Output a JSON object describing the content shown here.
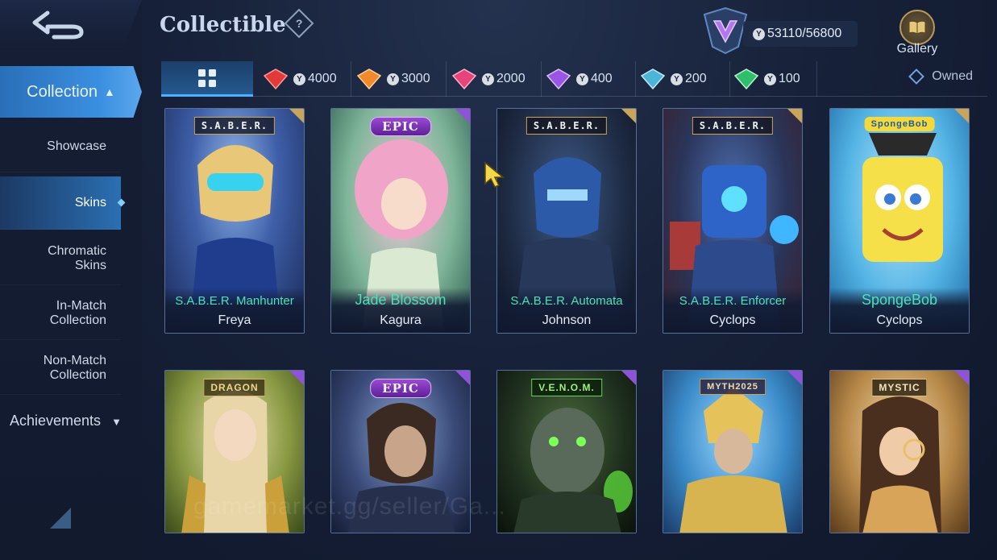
{
  "header": {
    "title": "Collectible",
    "help_symbol": "?",
    "points": "53110/56800",
    "gallery_label": "Gallery"
  },
  "sidebar": {
    "collection_label": "Collection",
    "items": [
      {
        "label": "Showcase"
      },
      {
        "label": "Skins",
        "active": true
      },
      {
        "label": "Chromatic\nSkins"
      },
      {
        "label": "In-Match\nCollection"
      },
      {
        "label": "Non-Match\nCollection"
      }
    ],
    "achievements_label": "Achievements"
  },
  "filters": {
    "tabs": [
      {
        "value": "4000",
        "color": "#e03a3a"
      },
      {
        "value": "3000",
        "color": "#f08a2a"
      },
      {
        "value": "2000",
        "color": "#e8437a"
      },
      {
        "value": "400",
        "color": "#9a55e6"
      },
      {
        "value": "200",
        "color": "#4cb6d8"
      },
      {
        "value": "100",
        "color": "#2fbf6b"
      }
    ],
    "owned_label": "Owned"
  },
  "cards": [
    {
      "badge": "S.A.B.E.R.",
      "skin": "S.A.B.E.R. Manhunter",
      "hero": "Freya"
    },
    {
      "badge": "EPIC",
      "skin": "Jade Blossom",
      "hero": "Kagura"
    },
    {
      "badge": "S.A.B.E.R.",
      "skin": "S.A.B.E.R. Automata",
      "hero": "Johnson"
    },
    {
      "badge": "S.A.B.E.R.",
      "skin": "S.A.B.E.R. Enforcer",
      "hero": "Cyclops"
    },
    {
      "badge": "SpongeBob",
      "skin": "SpongeBob",
      "hero": "Cyclops"
    },
    {
      "badge": "DRAGON"
    },
    {
      "badge": "EPIC"
    },
    {
      "badge": "V.E.N.O.M."
    },
    {
      "badge": "MYTH2025"
    },
    {
      "badge": "MYSTIC"
    }
  ],
  "watermark": "gamemarket.gg/seller/Ga..."
}
